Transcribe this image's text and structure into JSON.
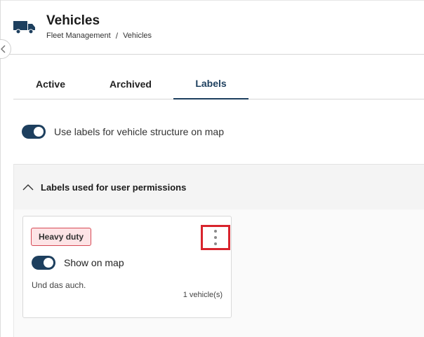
{
  "header": {
    "title": "Vehicles",
    "breadcrumb": [
      "Fleet Management",
      "Vehicles"
    ],
    "breadcrumb_separator": "/",
    "icon": "truck-icon"
  },
  "tabs": [
    {
      "label": "Active",
      "active": false
    },
    {
      "label": "Archived",
      "active": false
    },
    {
      "label": "Labels",
      "active": true
    }
  ],
  "map_toggle": {
    "label": "Use labels for vehicle structure on map",
    "on": true
  },
  "section": {
    "title": "Labels used for user permissions",
    "expanded": true,
    "icon": "chevron-up-icon"
  },
  "label_card": {
    "label": "Heavy duty",
    "show_on_map_label": "Show on map",
    "show_on_map": true,
    "description": "Und das auch.",
    "vehicle_count": "1 vehicle(s)",
    "menu_icon": "kebab-menu-icon"
  },
  "colors": {
    "accent": "#1d3f5e",
    "chip_bg": "#fde4e6",
    "chip_border": "#d64a55",
    "highlight": "#d8242d"
  }
}
